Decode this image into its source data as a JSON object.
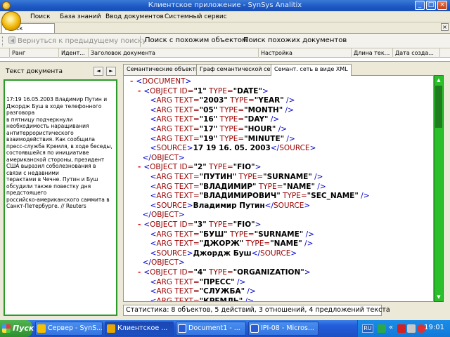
{
  "window": {
    "title": "Клиентское приложение - SynSys Analitix",
    "minimize": "_",
    "maximize": "□",
    "close": "×"
  },
  "menu": [
    "Поиск",
    "База знаний",
    "Ввод документов",
    "Системный сервис"
  ],
  "doc_tab": {
    "label": "Поиск документов",
    "close": "×"
  },
  "toolbar": {
    "back": "Вернуться к предыдущему поиску",
    "similar_object": "Поиск с похожим объектом",
    "similar_docs": "Поиск похожих документов"
  },
  "columns": [
    "Ранг",
    "Идент...",
    "Заголовок документа",
    "Настройка",
    "Длина тек...",
    "Дата созда..."
  ],
  "left_panel": {
    "title": "Текст документа",
    "prev": "◄",
    "next": "►",
    "text_lines": [
      "17:19 16.05.2003  Владимир Путин и",
      "Джордж Буш в ходе телефонного",
      "разговора",
      "в  пятницу  подчеркнули",
      "необходимость  наращивания",
      "антитеррористического",
      "взаимодействия. Как сообщила",
      "пресс-служба Кремля, в ходе беседы,",
      "состоявшейся по инициативе",
      "американской стороны, президент",
      "США выразил соболезнования в",
      "связи с недавними",
      "терактами в Чечне. Путин и Буш",
      "обсудили также повестку дня",
      "предстоящего",
      "российско-американского саммита в",
      "Санкт-Петербурге.  // Reuters"
    ]
  },
  "tabs": [
    "Семантические объекты",
    "Граф семантической сети",
    "Семант. сеть в виде XML"
  ],
  "xml": {
    "root": "DOCUMENT",
    "objects": [
      {
        "id": "1",
        "type": "DATE",
        "args": [
          {
            "text": "2003",
            "type": "YEAR"
          },
          {
            "text": "05",
            "type": "MONTH"
          },
          {
            "text": "16",
            "type": "DAY"
          },
          {
            "text": "17",
            "type": "HOUR"
          },
          {
            "text": "19",
            "type": "MINUTE"
          }
        ],
        "source": "17 19 16. 05. 2003"
      },
      {
        "id": "2",
        "type": "FIO",
        "args": [
          {
            "text": "ПУТИН",
            "type": "SURNAME"
          },
          {
            "text": "ВЛАДИМИР",
            "type": "NAME"
          },
          {
            "text": "ВЛАДИМИРОВИЧ",
            "type": "SEC_NAME"
          }
        ],
        "source": "Владимир Путин"
      },
      {
        "id": "3",
        "type": "FIO",
        "args": [
          {
            "text": "БУШ",
            "type": "SURNAME"
          },
          {
            "text": "ДЖОРЖ",
            "type": "NAME"
          }
        ],
        "source": "Джордж Буш"
      },
      {
        "id": "4",
        "type": "ORGANIZATION",
        "args": [
          {
            "text": "ПРЕСС"
          },
          {
            "text": "СЛУЖБА"
          },
          {
            "text": "КРЕМЛЬ"
          }
        ]
      }
    ]
  },
  "status": "Статистика: 8 объектов, 5 действий, 3 отношений, 4 предложений текста",
  "taskbar": {
    "start": "Пуск",
    "tasks": [
      "Сервер - SynS...",
      "Клиентское ...",
      "Document1 - ...",
      "IPI-08 - Micros..."
    ],
    "lang": "RU",
    "tray_chevron": "«",
    "clock": "19:01"
  },
  "colors": {
    "accent_green": "#2cbf2c",
    "xml_tag": "#990000",
    "xml_bracket": "#0000cc",
    "xml_minus": "#e00000"
  }
}
